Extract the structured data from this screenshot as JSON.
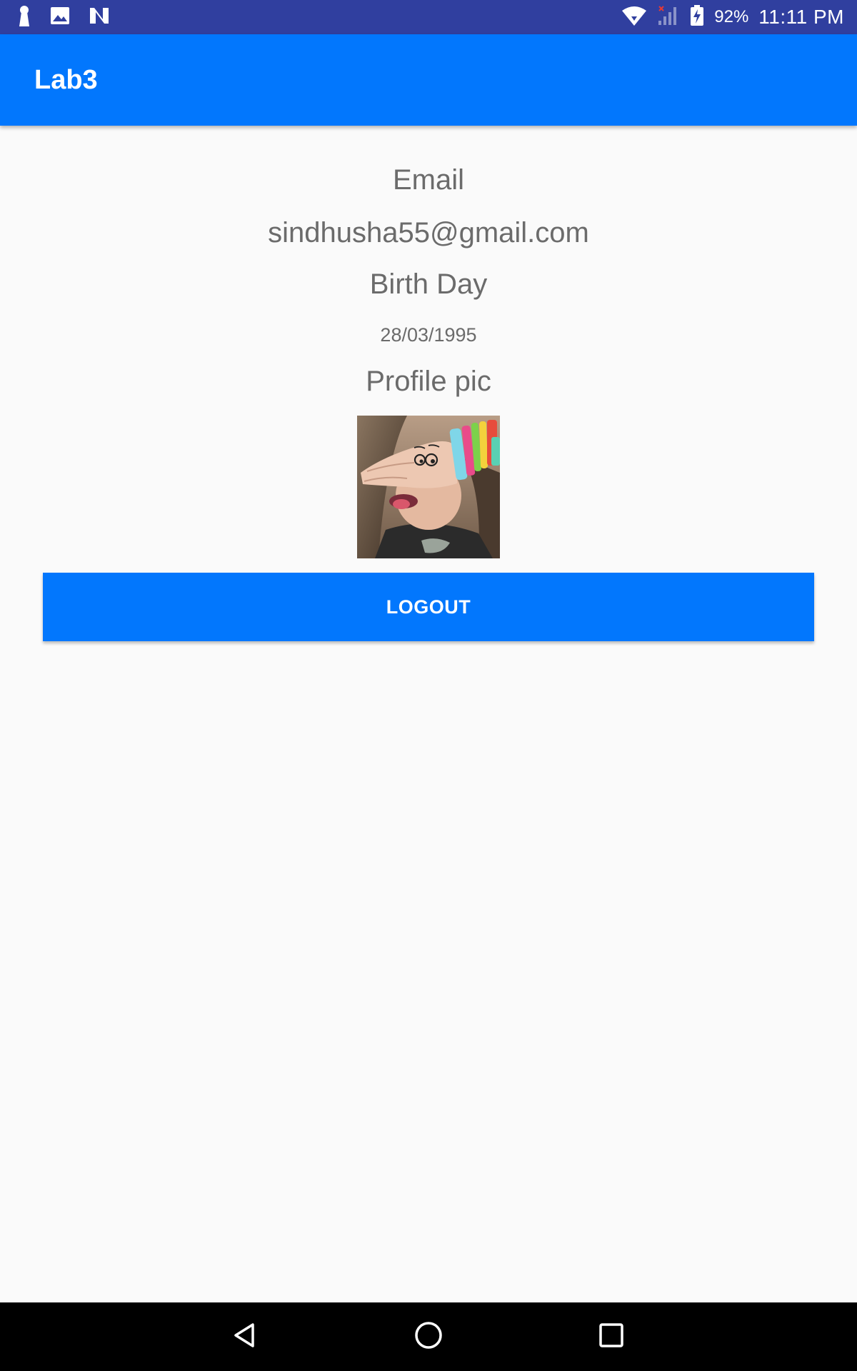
{
  "status_bar": {
    "battery_percent": "92%",
    "time": "11:11 PM",
    "icons": [
      "keyhole-notification-icon",
      "image-notification-icon",
      "n-notification-icon",
      "wifi-icon",
      "cell-signal-icon",
      "battery-charging-icon"
    ]
  },
  "app_bar": {
    "title": "Lab3",
    "color": "#0277fd"
  },
  "profile": {
    "email_label": "Email",
    "email_value": "sindhusha55@gmail.com",
    "birthday_label": "Birth Day",
    "birthday_value": "28/03/1995",
    "profile_pic_label": "Profile pic"
  },
  "actions": {
    "logout_label": "LOGOUT"
  },
  "nav_bar": {
    "icons": [
      "back-icon",
      "home-icon",
      "recents-icon"
    ]
  },
  "colors": {
    "status_bar": "#303f9f",
    "primary": "#0277fd",
    "background": "#fafafa",
    "text_secondary": "#6b6b6b"
  }
}
